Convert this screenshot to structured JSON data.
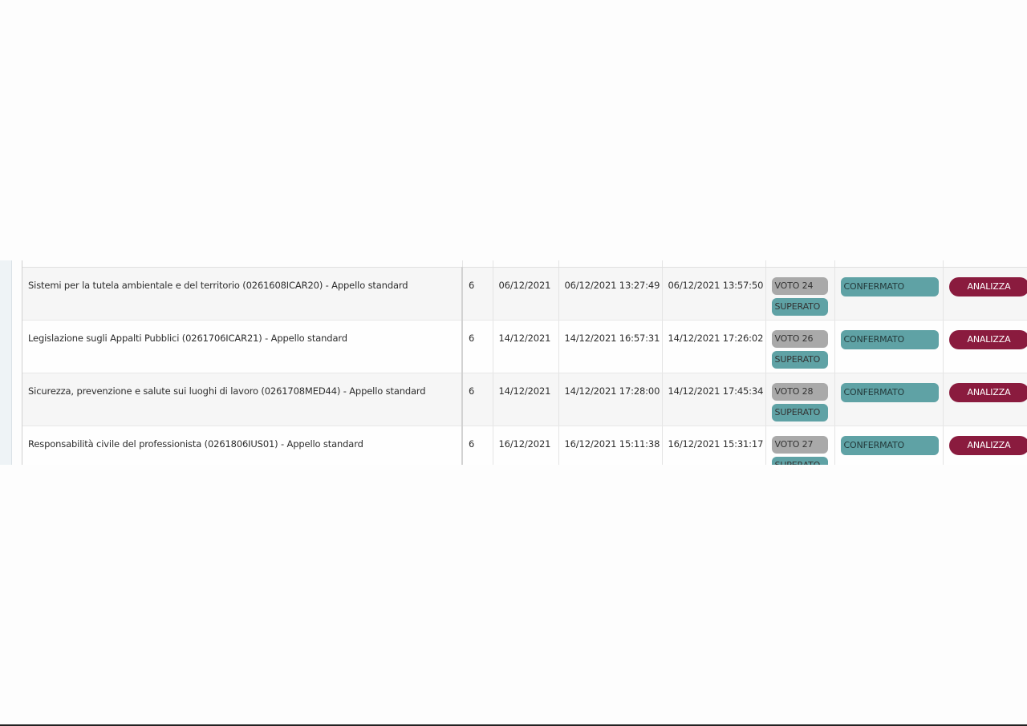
{
  "rows": [
    {
      "name": "Sistemi per la tutela ambientale e del territorio (0261608ICAR20) - Appello standard",
      "credits": "6",
      "date": "06/12/2021",
      "start": "06/12/2021 13:27:49",
      "end": "06/12/2021 13:57:50",
      "vote": "VOTO 24",
      "outcome": "SUPERATO",
      "status": "CONFERMATO",
      "action": "ANALIZZA"
    },
    {
      "name": "Legislazione sugli Appalti Pubblici (0261706ICAR21) - Appello standard",
      "credits": "6",
      "date": "14/12/2021",
      "start": "14/12/2021 16:57:31",
      "end": "14/12/2021 17:26:02",
      "vote": "VOTO 26",
      "outcome": "SUPERATO",
      "status": "CONFERMATO",
      "action": "ANALIZZA"
    },
    {
      "name": "Sicurezza, prevenzione e salute sui luoghi di lavoro (0261708MED44) - Appello standard",
      "credits": "6",
      "date": "14/12/2021",
      "start": "14/12/2021 17:28:00",
      "end": "14/12/2021 17:45:34",
      "vote": "VOTO 28",
      "outcome": "SUPERATO",
      "status": "CONFERMATO",
      "action": "ANALIZZA"
    },
    {
      "name": "Responsabilità civile del professionista (0261806IUS01) - Appello standard",
      "credits": "6",
      "date": "16/12/2021",
      "start": "16/12/2021 15:11:38",
      "end": "16/12/2021 15:31:17",
      "vote": "VOTO 27",
      "outcome": "SUPERATO",
      "status": "CONFERMATO",
      "action": "ANALIZZA"
    }
  ],
  "colors": {
    "vote_badge": "#a9a9a9",
    "teal_badge": "#5fa2a5",
    "action_button": "#8a1b3e"
  }
}
